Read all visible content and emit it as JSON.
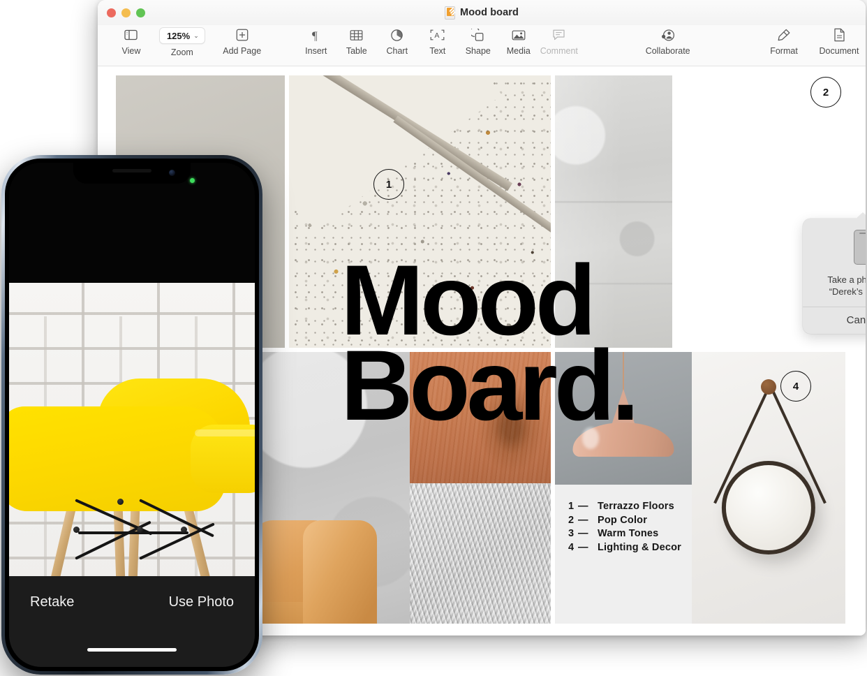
{
  "window": {
    "title": "Mood board",
    "doc_icon": "keynote-document-icon",
    "traffic_lights": {
      "close": "close-button",
      "minimize": "minimize-button",
      "zoom": "zoom-button"
    }
  },
  "toolbar": {
    "items": [
      {
        "label": "View",
        "icon": "sidebar-icon",
        "dim": false
      },
      {
        "label": "Zoom",
        "icon": "zoom-value",
        "value": "125%",
        "chevron": "⌄",
        "dim": false
      },
      {
        "label": "Add Page",
        "icon": "add-page-icon",
        "dim": false
      },
      {
        "label": "Insert",
        "icon": "pilcrow-icon",
        "dim": false
      },
      {
        "label": "Table",
        "icon": "table-icon",
        "dim": false
      },
      {
        "label": "Chart",
        "icon": "chart-pie-icon",
        "dim": false
      },
      {
        "label": "Text",
        "icon": "text-box-icon",
        "dim": false
      },
      {
        "label": "Shape",
        "icon": "shape-icon",
        "dim": false
      },
      {
        "label": "Media",
        "icon": "media-image-icon",
        "dim": false
      },
      {
        "label": "Comment",
        "icon": "comment-icon",
        "dim": true
      },
      {
        "label": "Collaborate",
        "icon": "collaborate-icon",
        "dim": false
      },
      {
        "label": "Format",
        "icon": "format-brush-icon",
        "dim": false
      },
      {
        "label": "Document",
        "icon": "document-icon",
        "dim": false
      }
    ]
  },
  "document": {
    "headline_line1": "Mood",
    "headline_line2": "Board.",
    "badges": [
      {
        "number": "1",
        "refers_to": "Terrazzo Floors"
      },
      {
        "number": "2",
        "refers_to": "Pop Color"
      },
      {
        "number": "4",
        "refers_to": "Lighting & Decor"
      }
    ],
    "legend": {
      "dash": "—",
      "rows": [
        {
          "num": "1",
          "label": "Terrazzo Floors"
        },
        {
          "num": "2",
          "label": "Pop Color"
        },
        {
          "num": "3",
          "label": "Warm Tones"
        },
        {
          "num": "4",
          "label": "Lighting & Decor"
        }
      ]
    },
    "images": [
      {
        "name": "warm-grey-wall-swatch"
      },
      {
        "name": "terrazzo-slab-photo"
      },
      {
        "name": "concrete-wall-photo"
      },
      {
        "name": "plaster-wall-with-tan-sofa-photo"
      },
      {
        "name": "oak-wood-grain-photo"
      },
      {
        "name": "grey-shag-rug-photo"
      },
      {
        "name": "blush-pendant-lamp-photo"
      },
      {
        "name": "round-leather-strap-mirror-photo"
      }
    ]
  },
  "popover": {
    "device_icon": "iphone-icon",
    "message_line1": "Take a photo with",
    "message_line2": "“Derek’s iPhone”",
    "cancel_label": "Cancel"
  },
  "iphone": {
    "preview_subject": "yellow-eames-style-chair-against-white-brick-wall",
    "retake_label": "Retake",
    "use_photo_label": "Use Photo",
    "status_indicator": "green-camera-in-use-dot"
  },
  "colors": {
    "accent_yellow": "#ffd900",
    "window_bg": "#ffffff",
    "toolbar_bg": "#fafafa",
    "popover_bg": "#e6e6e6",
    "legend_bg": "#efefef",
    "title_black": "#000000",
    "traffic_red": "#ec6a5e",
    "traffic_yellow": "#f4bd4f",
    "traffic_green": "#61c454"
  }
}
